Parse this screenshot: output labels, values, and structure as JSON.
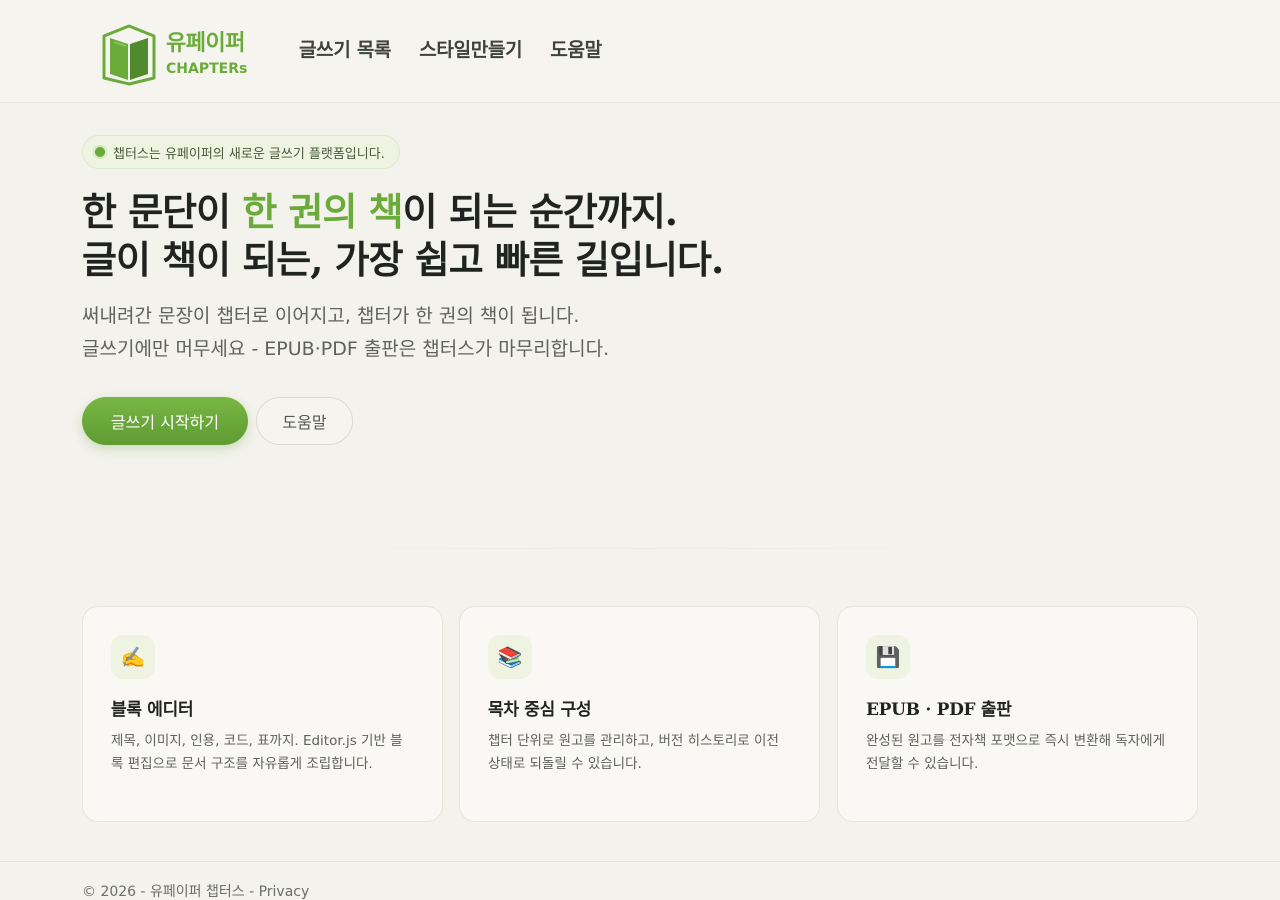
{
  "header": {
    "logo": {
      "ko": "유페이퍼",
      "en": "CHAPTERs"
    },
    "nav": [
      {
        "label": "글쓰기 목록"
      },
      {
        "label": "스타일만들기"
      },
      {
        "label": "도움말"
      }
    ]
  },
  "hero": {
    "pill": "챕터스는 유페이퍼의 새로운 글쓰기 플랫폼입니다.",
    "title_line1_pre": "한 문단이 ",
    "title_line1_accent": "한 권의 책",
    "title_line1_post": "이 되는 순간까지.",
    "title_line2": "글이 책이 되는, 가장 쉽고 빠른 길입니다.",
    "sub_line1": "써내려간 문장이 챕터로 이어지고, 챕터가 한 권의 책이 됩니다.",
    "sub_line2": "글쓰기에만 머무세요 - EPUB·PDF 출판은 챕터스가 마무리합니다.",
    "primary_button": "글쓰기 시작하기",
    "secondary_button": "도움말"
  },
  "features": [
    {
      "icon": "✍️",
      "icon_name": "writing-hand-icon",
      "title": "블록 에디터",
      "desc": "제목, 이미지, 인용, 코드, 표까지. Editor.js 기반 블록 편집으로 문서 구조를 자유롭게 조립합니다."
    },
    {
      "icon": "📚",
      "icon_name": "books-icon",
      "title": "목차 중심 구성",
      "desc": "챕터 단위로 원고를 관리하고, 버전 히스토리로 이전 상태로 되돌릴 수 있습니다."
    },
    {
      "icon": "💾",
      "icon_name": "floppy-disk-icon",
      "title": "EPUB · PDF 출판",
      "desc": "완성된 원고를 전자책 포맷으로 즉시 변환해 독자에게 전달할 수 있습니다."
    }
  ],
  "footer": {
    "text": "© 2026 - 유페이퍼 챕터스 - Privacy"
  },
  "colors": {
    "accent": "#6aab3a",
    "background": "#f3f2ec"
  }
}
